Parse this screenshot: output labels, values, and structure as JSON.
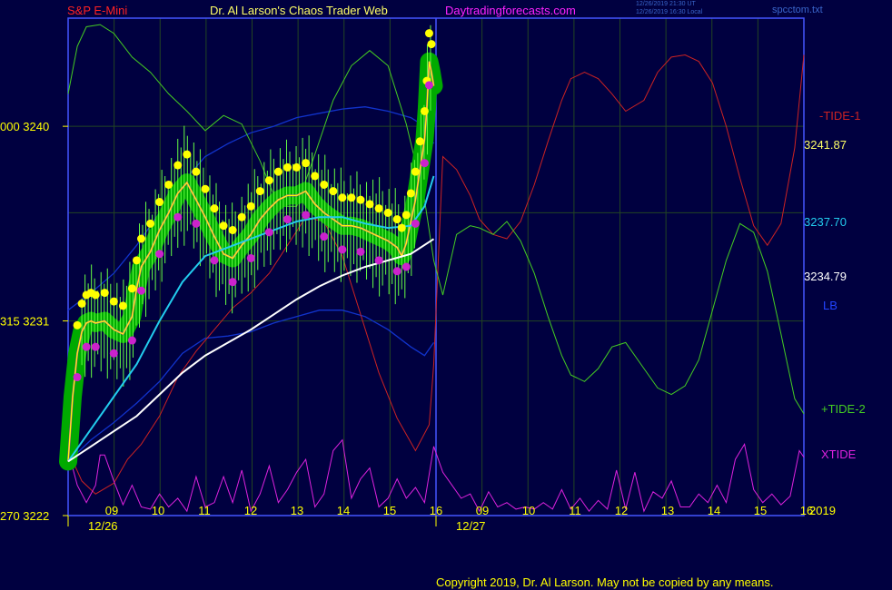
{
  "header": {
    "left_title": "S&P E-Mini",
    "center_title": "Dr. Al Larson's Chaos Trader Web",
    "site": "Daytradingforecasts.com",
    "stamp_utc": "12/26/2019 21:30 UT",
    "stamp_local": "12/26/2019 16:30 Local",
    "file": "spcctom.txt"
  },
  "footer": {
    "copyright": "Copyright 2019, Dr. Al Larson. May not be copied by any means."
  },
  "colors": {
    "background": "#000040",
    "frame": "#4455ff",
    "grid": "#224422",
    "price": "#ffff00",
    "band": "#00aa00",
    "dot_high": "#ffff00",
    "dot_low": "#cc22cc",
    "tide1": "#cc2222",
    "tide2": "#44cc22",
    "xtide": "#dd22dd",
    "cyan": "#22ccee",
    "white": "#ffffff",
    "envelope": "#1133cc",
    "magenta_avg": "#dd22dd"
  },
  "chart_data": {
    "type": "line",
    "title": "S&P E-Mini",
    "ylim": [
      3222,
      3245
    ],
    "left_axis_labels": [
      {
        "value": 3240,
        "text": "000  3240"
      },
      {
        "value": 3231,
        "text": "315  3231"
      },
      {
        "value": 3222,
        "text": "270  3222"
      }
    ],
    "x_ticks": [
      "09",
      "10",
      "11",
      "12",
      "13",
      "14",
      "15",
      "16",
      "09",
      "10",
      "11",
      "12",
      "13",
      "14",
      "15",
      "16"
    ],
    "x_extra_right": "2019",
    "dates": [
      "12/26",
      "12/27"
    ],
    "right_labels": [
      {
        "text": "-TIDE-1",
        "color": "#cc2222"
      },
      {
        "text": "LB",
        "color": "#2244ff"
      },
      {
        "text": "3241.87",
        "color": "#ffff66"
      },
      {
        "text": "3237.70",
        "color": "#22ccee"
      },
      {
        "text": "3234.79",
        "color": "#ffffff"
      },
      {
        "text": "LB",
        "color": "#2244ff"
      },
      {
        "text": "+TIDE-2",
        "color": "#44cc22"
      },
      {
        "text": "XTIDE",
        "color": "#dd22dd"
      }
    ],
    "series": [
      {
        "name": "price",
        "color": "#ffff00",
        "x": [
          0,
          0.1,
          0.2,
          0.3,
          0.4,
          0.5,
          0.6,
          0.8,
          1.0,
          1.2,
          1.4,
          1.5,
          1.6,
          1.8,
          2.0,
          2.2,
          2.4,
          2.6,
          2.8,
          3.0,
          3.2,
          3.4,
          3.6,
          3.8,
          4.0,
          4.2,
          4.4,
          4.6,
          4.8,
          5.0,
          5.2,
          5.4,
          5.6,
          5.8,
          6.0,
          6.2,
          6.4,
          6.6,
          6.8,
          7.0,
          7.2,
          7.3,
          7.4,
          7.5,
          7.6,
          7.7,
          7.8,
          7.85,
          7.9,
          7.95,
          8.0
        ],
        "y": [
          3224.5,
          3227.5,
          3229.5,
          3230.5,
          3230.9,
          3231.0,
          3230.9,
          3231.0,
          3230.6,
          3230.4,
          3231.2,
          3232.5,
          3233.5,
          3234.2,
          3235.2,
          3236.0,
          3236.9,
          3237.4,
          3236.6,
          3235.8,
          3234.9,
          3234.1,
          3233.9,
          3234.5,
          3235.0,
          3235.7,
          3236.2,
          3236.6,
          3236.8,
          3236.8,
          3237.0,
          3236.4,
          3236.0,
          3235.7,
          3235.4,
          3235.4,
          3235.3,
          3235.1,
          3234.9,
          3234.7,
          3234.4,
          3234.0,
          3234.6,
          3235.6,
          3236.6,
          3238.0,
          3239.4,
          3240.8,
          3243.0,
          3242.5,
          3241.87
        ]
      },
      {
        "name": "cyan_average",
        "color": "#22ccee",
        "x": [
          0,
          0.5,
          1.0,
          1.5,
          2.0,
          2.5,
          3.0,
          3.5,
          4.0,
          4.5,
          5.0,
          5.5,
          6.0,
          6.5,
          7.0,
          7.5,
          7.8,
          8.0
        ],
        "y": [
          3224.5,
          3226.0,
          3227.5,
          3229.0,
          3231.0,
          3232.8,
          3234.0,
          3234.4,
          3234.8,
          3235.2,
          3235.6,
          3235.8,
          3235.8,
          3235.5,
          3235.3,
          3235.4,
          3236.3,
          3237.7
        ]
      },
      {
        "name": "white_average",
        "color": "#ffffff",
        "x": [
          0,
          0.5,
          1.0,
          1.5,
          2.0,
          2.5,
          3.0,
          3.5,
          4.0,
          4.5,
          5.0,
          5.5,
          6.0,
          6.5,
          7.0,
          7.5,
          8.0
        ],
        "y": [
          3224.5,
          3225.2,
          3225.9,
          3226.6,
          3227.6,
          3228.6,
          3229.4,
          3230.0,
          3230.6,
          3231.3,
          3232.0,
          3232.6,
          3233.1,
          3233.5,
          3233.8,
          3234.1,
          3234.79
        ]
      },
      {
        "name": "upper_envelope",
        "color": "#1133cc",
        "x": [
          0,
          0.5,
          1.0,
          1.5,
          2.0,
          2.5,
          3.0,
          3.5,
          4.0,
          4.5,
          5.0,
          5.5,
          6.0,
          6.5,
          7.0,
          7.5,
          7.8,
          8.0
        ],
        "y": [
          3231.5,
          3232.3,
          3233.2,
          3234.5,
          3236.0,
          3237.4,
          3238.6,
          3239.2,
          3239.7,
          3240.0,
          3240.4,
          3240.6,
          3240.8,
          3240.9,
          3240.7,
          3240.4,
          3240.0,
          3239.2
        ]
      },
      {
        "name": "lower_envelope",
        "color": "#1133cc",
        "x": [
          0,
          0.5,
          1.0,
          1.5,
          2.0,
          2.5,
          3.0,
          3.5,
          4.0,
          4.5,
          5.0,
          5.5,
          6.0,
          6.5,
          7.0,
          7.5,
          7.8,
          8.0
        ],
        "y": [
          3224.5,
          3225.5,
          3226.3,
          3227.2,
          3228.2,
          3229.5,
          3230.2,
          3230.3,
          3230.5,
          3230.9,
          3231.2,
          3231.5,
          3231.5,
          3231.2,
          3230.6,
          3229.8,
          3229.4,
          3230.0
        ]
      },
      {
        "name": "-TIDE-1",
        "color": "#cc2222",
        "x": [
          0,
          0.3,
          0.6,
          1.0,
          1.3,
          1.6,
          2.0,
          2.4,
          2.8,
          3.2,
          3.6,
          4.0,
          4.4,
          4.8,
          5.2,
          5.6,
          6.0,
          6.4,
          6.8,
          7.2,
          7.6,
          7.9,
          8.0,
          8.2,
          8.5,
          8.8,
          9.0,
          9.3,
          9.6,
          9.9,
          10.2,
          10.5,
          10.8,
          11.0,
          11.3,
          11.6,
          11.9,
          12.2,
          12.6,
          12.9,
          13.2,
          13.5,
          13.8,
          14.1,
          14.4,
          14.7,
          15.0,
          15.3,
          15.6,
          15.9,
          16.1
        ],
        "y": [
          3225.0,
          3223.6,
          3223.0,
          3223.5,
          3224.6,
          3225.3,
          3226.6,
          3228.4,
          3229.6,
          3230.6,
          3231.6,
          3232.3,
          3233.2,
          3234.5,
          3235.8,
          3235.6,
          3234.0,
          3231.3,
          3228.6,
          3226.5,
          3225.0,
          3226.2,
          3229.0,
          3238.6,
          3238.0,
          3236.8,
          3235.7,
          3235.0,
          3234.8,
          3235.6,
          3237.3,
          3239.3,
          3241.2,
          3242.2,
          3242.5,
          3242.2,
          3241.5,
          3240.7,
          3241.2,
          3242.5,
          3243.2,
          3243.3,
          3243.0,
          3242.0,
          3240.0,
          3237.6,
          3235.4,
          3234.5,
          3235.5,
          3239.0,
          3243.3
        ]
      },
      {
        "name": "+TIDE-2",
        "color": "#44cc22",
        "x": [
          0,
          0.2,
          0.4,
          0.7,
          1.0,
          1.4,
          1.8,
          2.2,
          2.6,
          3.0,
          3.4,
          3.8,
          4.2,
          4.6,
          5.0,
          5.4,
          5.8,
          6.2,
          6.6,
          7.0,
          7.4,
          7.8,
          8.0,
          8.2,
          8.5,
          8.8,
          9.0,
          9.3,
          9.6,
          9.9,
          10.2,
          10.5,
          10.8,
          11.0,
          11.3,
          11.6,
          11.9,
          12.2,
          12.6,
          12.9,
          13.2,
          13.5,
          13.8,
          14.1,
          14.4,
          14.7,
          15.0,
          15.3,
          15.6,
          15.9,
          16.1
        ],
        "y": [
          3241.5,
          3243.7,
          3244.6,
          3244.7,
          3244.3,
          3243.2,
          3242.5,
          3241.5,
          3240.7,
          3239.8,
          3240.5,
          3240.1,
          3238.4,
          3236.3,
          3236.3,
          3238.7,
          3241.2,
          3242.8,
          3243.5,
          3242.8,
          3240.1,
          3236.6,
          3233.8,
          3232.2,
          3235.0,
          3235.4,
          3235.3,
          3235.0,
          3235.6,
          3234.7,
          3233.2,
          3231.2,
          3229.4,
          3228.5,
          3228.2,
          3228.8,
          3229.8,
          3230.0,
          3228.8,
          3227.9,
          3227.6,
          3228.0,
          3229.2,
          3231.5,
          3233.8,
          3235.5,
          3235.1,
          3233.3,
          3230.4,
          3227.4,
          3226.7
        ]
      },
      {
        "name": "XTIDE",
        "color": "#dd22dd",
        "x": [
          0,
          0.2,
          0.4,
          0.6,
          0.7,
          0.8,
          1.0,
          1.2,
          1.4,
          1.6,
          1.8,
          2.0,
          2.2,
          2.4,
          2.6,
          2.8,
          3.0,
          3.2,
          3.4,
          3.6,
          3.8,
          4.0,
          4.2,
          4.4,
          4.6,
          4.8,
          5.0,
          5.2,
          5.4,
          5.6,
          5.8,
          6.0,
          6.2,
          6.4,
          6.6,
          6.8,
          7.0,
          7.2,
          7.4,
          7.6,
          7.8,
          8.0,
          8.2,
          8.4,
          8.6,
          8.8,
          9.0,
          9.2,
          9.4,
          9.6,
          9.8,
          10.0,
          10.2,
          10.4,
          10.6,
          10.8,
          11.0,
          11.2,
          11.4,
          11.6,
          11.8,
          12.0,
          12.2,
          12.4,
          12.6,
          12.8,
          13.0,
          13.2,
          13.4,
          13.6,
          13.8,
          14.0,
          14.2,
          14.4,
          14.6,
          14.8,
          15.0,
          15.2,
          15.4,
          15.6,
          15.8,
          16.0,
          16.1
        ],
        "y": [
          3225.0,
          3223.4,
          3222.6,
          3223.4,
          3224.8,
          3224.8,
          3223.6,
          3222.5,
          3223.4,
          3222.4,
          3222.3,
          3223.0,
          3222.4,
          3222.8,
          3222.2,
          3223.8,
          3222.4,
          3222.6,
          3223.8,
          3222.6,
          3224.1,
          3222.2,
          3223.0,
          3224.3,
          3222.6,
          3223.2,
          3224.0,
          3224.6,
          3222.4,
          3223.0,
          3225.0,
          3225.5,
          3222.8,
          3223.7,
          3224.2,
          3222.4,
          3222.8,
          3223.7,
          3222.8,
          3223.3,
          3222.6,
          3225.2,
          3224.0,
          3223.4,
          3222.8,
          3223.0,
          3222.2,
          3223.1,
          3222.4,
          3222.6,
          3222.3,
          3222.4,
          3222.3,
          3222.6,
          3222.3,
          3223.2,
          3222.3,
          3222.8,
          3222.2,
          3222.7,
          3222.3,
          3224.1,
          3222.3,
          3224.0,
          3222.2,
          3223.1,
          3222.8,
          3223.6,
          3222.4,
          3222.4,
          3223.0,
          3222.6,
          3223.4,
          3222.6,
          3224.6,
          3225.3,
          3223.2,
          3222.6,
          3223.0,
          3222.5,
          3222.9,
          3225.0,
          3224.7
        ]
      }
    ]
  }
}
